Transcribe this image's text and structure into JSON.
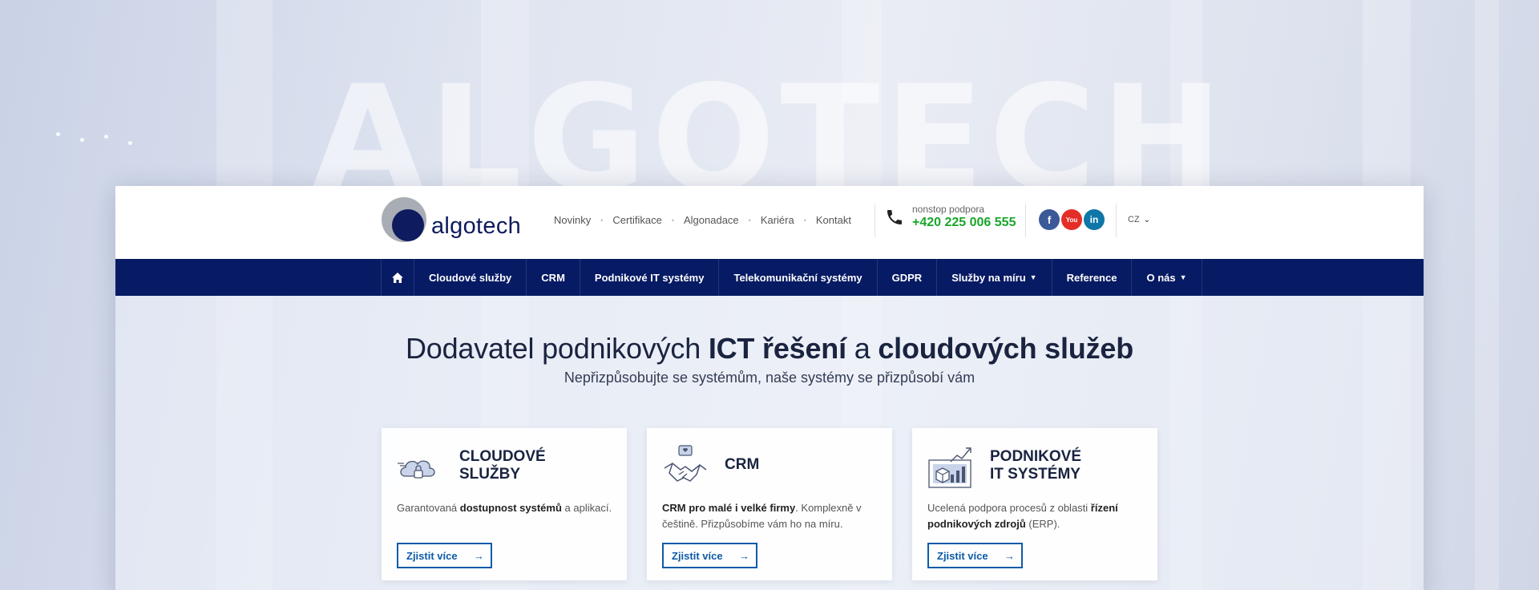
{
  "background": {
    "watermark": "ALGOTECH"
  },
  "header": {
    "logo_text": "algotech",
    "top_links": [
      "Novinky",
      "Certifikace",
      "Algonadace",
      "Kariéra",
      "Kontakt"
    ],
    "support_label": "nonstop podpora",
    "support_phone": "+420 225 006 555",
    "social": {
      "facebook": "f",
      "youtube": "You",
      "linkedin": "in"
    },
    "language": "CZ"
  },
  "mainnav": {
    "items": [
      "Cloudové služby",
      "CRM",
      "Podnikové IT systémy",
      "Telekomunikační systémy",
      "GDPR",
      "Služby na míru",
      "Reference",
      "O nás"
    ]
  },
  "hero": {
    "title_part1": "Dodavatel podnikových ",
    "title_bold1": "ICT řešení",
    "title_part2": " a ",
    "title_bold2": "cloudových služeb",
    "subtitle": "Nepřizpůsobujte se systémům, naše systémy se přizpůsobí vám"
  },
  "cards": [
    {
      "title": "CLOUDOVÉ\nSLUŽBY",
      "desc_pre": "Garantovaná ",
      "desc_bold": "dostupnost systémů",
      "desc_post": " a aplikací.",
      "button": "Zjistit více"
    },
    {
      "title": "CRM",
      "desc_pre": "",
      "desc_bold": "CRM pro malé i velké firmy",
      "desc_post": ". Komplexně v češtině. Přizpůsobíme vám ho na míru.",
      "button": "Zjistit více"
    },
    {
      "title": "PODNIKOVÉ\nIT SYSTÉMY",
      "desc_pre": "Ucelená podpora procesů z oblasti ",
      "desc_bold": "řízení podnikových zdrojů",
      "desc_post": " (ERP).",
      "button": "Zjistit více"
    }
  ],
  "colors": {
    "nav_bg": "#071a64",
    "accent": "#0d5ba8",
    "phone": "#1aa52a",
    "brand": "#0e1b5e"
  }
}
